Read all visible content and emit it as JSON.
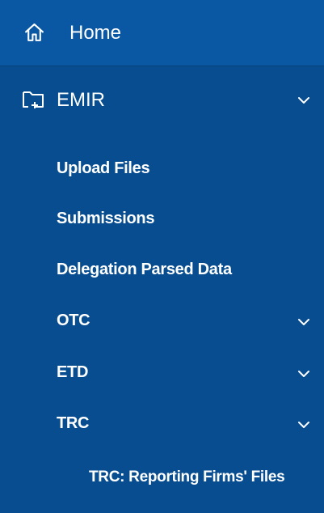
{
  "nav": {
    "home": {
      "label": "Home",
      "icon": "home-icon"
    },
    "emir": {
      "label": "EMIR",
      "icon": "folder-plus-icon",
      "expanded": true,
      "items": [
        {
          "label": "Upload Files"
        },
        {
          "label": "Submissions"
        },
        {
          "label": "Delegation Parsed Data"
        },
        {
          "label": "OTC",
          "has_children": true
        },
        {
          "label": "ETD",
          "has_children": true
        },
        {
          "label": "TRC",
          "has_children": true,
          "expanded": true,
          "children": [
            {
              "label": "TRC: Reporting Firms' Files"
            }
          ]
        }
      ]
    }
  },
  "colors": {
    "background": "#074d90",
    "active": "#0a58a3",
    "text": "#ffffff"
  }
}
